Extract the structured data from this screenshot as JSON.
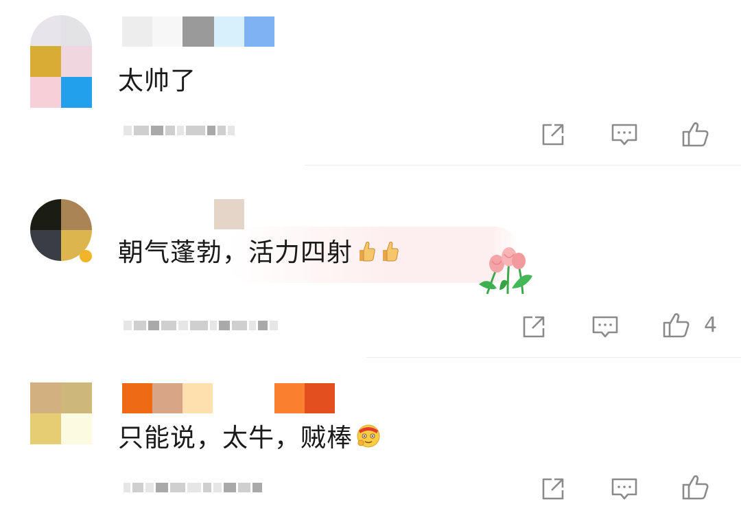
{
  "comments": [
    {
      "text": "太帅了",
      "like_count": "",
      "actions": [
        "share-icon",
        "comment-icon",
        "like-icon"
      ]
    },
    {
      "text": "朝气蓬勃，活力四射",
      "like_count": "4",
      "emoji": "thumbs-up-icon",
      "decoration": "tulip-icon",
      "actions": [
        "share-icon",
        "comment-icon",
        "like-icon"
      ]
    },
    {
      "text": "只能说，太牛，贼棒",
      "like_count": "",
      "emoji": "strong-face-icon",
      "actions": [
        "share-icon",
        "comment-icon",
        "like-icon"
      ]
    }
  ],
  "colors": {
    "text": "#1a1a1a",
    "icon": "#8a8a8a",
    "divider": "#ececec"
  }
}
